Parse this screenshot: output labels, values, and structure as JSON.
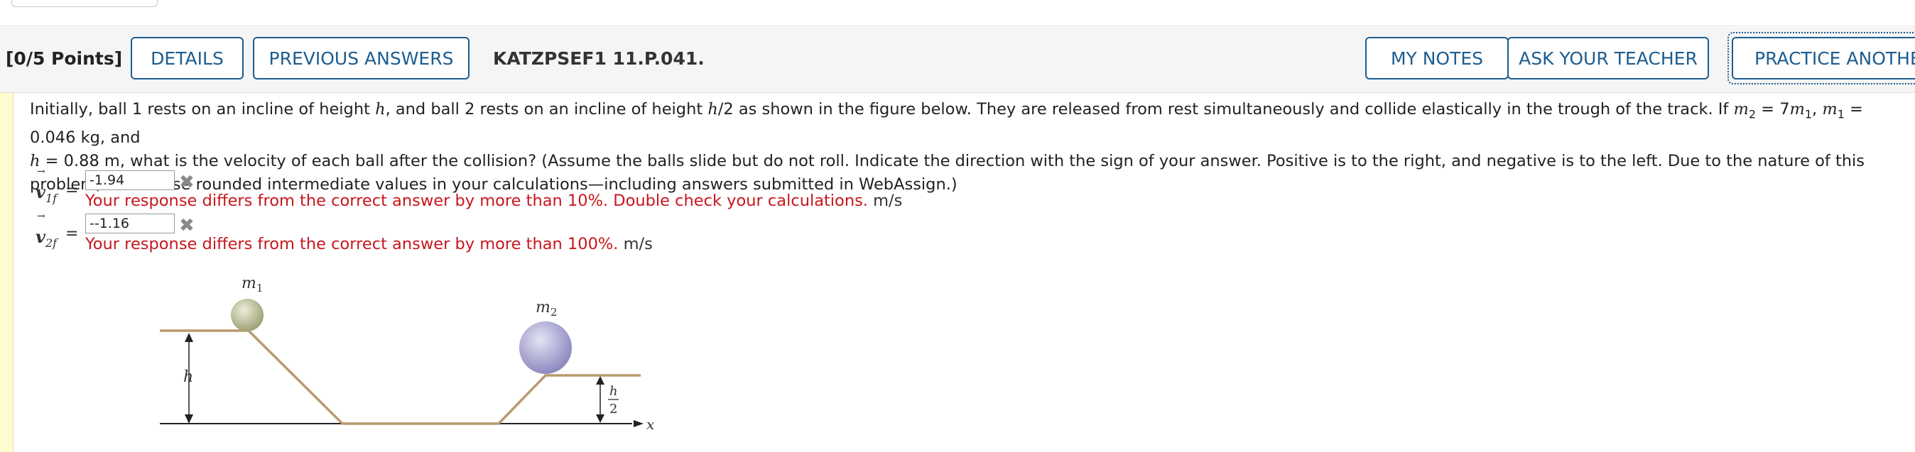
{
  "header": {
    "points": "[0/5 Points]",
    "details_label": "DETAILS",
    "previous_answers_label": "PREVIOUS ANSWERS",
    "question_id": "KATZPSEF1 11.P.041.",
    "my_notes_label": "MY NOTES",
    "ask_teacher_label": "ASK YOUR TEACHER",
    "practice_label": "PRACTICE ANOTHER"
  },
  "question": {
    "p1": "Initially, ball 1 rests on an incline of height ",
    "h": "h",
    "p2": ", and ball 2 rests on an incline of height ",
    "h2": "h",
    "p3": "/2 as shown in the figure below. They are released from rest simultaneously and collide elastically in the trough of the track. If ",
    "m": "m",
    "sub2": "2",
    "eq1": " = 7",
    "m1b": "m",
    "sub1b": "1",
    "comma1": ",  ",
    "m1c": "m",
    "sub1c": "1",
    "eq2": " = ",
    "mass_value": "0.046",
    "mass_unit": " kg,  and",
    "h3": "h",
    "eq3": " = ",
    "h_value": "0.88",
    "rest": " m,  what is the velocity of each ball after the collision? (Assume the balls slide but do not roll. Indicate the direction with the sign of your answer. Positive is to the right, and negative is to the left. Due to the nature of this problem, do not use rounded intermediate values in your calculations—including answers submitted in WebAssign.)"
  },
  "answers": [
    {
      "vector": "v",
      "sub": "1f",
      "equals": "=",
      "value": "-1.94",
      "feedback": "Your response differs from the correct answer by more than 10%. Double check your calculations.",
      "unit": "m/s",
      "status_icon": "x-mark-icon"
    },
    {
      "vector": "v",
      "sub": "2f",
      "equals": "=",
      "value": "--1.16",
      "feedback": "Your response differs from the correct answer by more than 100%.",
      "unit": "m/s",
      "status_icon": "x-mark-icon"
    }
  ],
  "figure": {
    "ball1_label": "m",
    "ball1_sub": "1",
    "ball2_label": "m",
    "ball2_sub": "2",
    "h_label": "h",
    "half_num": "h",
    "half_den": "2",
    "x_label": "x"
  },
  "colors": {
    "accent": "#1d5d90",
    "error": "#c8161d",
    "track": "#b89a6e",
    "ball1": "#b7b98f",
    "ball2": "#a9a6cf"
  }
}
